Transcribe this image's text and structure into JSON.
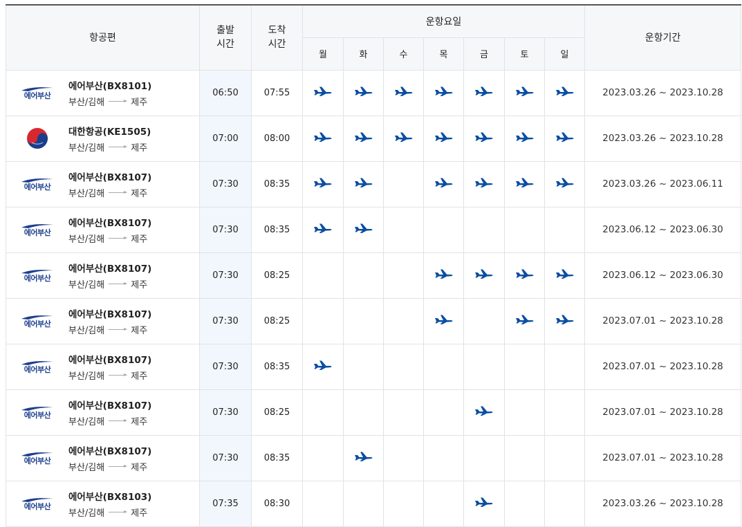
{
  "headers": {
    "flight": "항공편",
    "departure": "출발\n시간",
    "arrival": "도착\n시간",
    "days_group": "운항요일",
    "period": "운항기간",
    "days": [
      "월",
      "화",
      "수",
      "목",
      "금",
      "토",
      "일"
    ]
  },
  "rows": [
    {
      "airline": "에어부산(BX8101)",
      "logo": "air-busan-logo",
      "origin": "부산/김해",
      "destination": "제주",
      "dep": "06:50",
      "arr": "07:55",
      "days": [
        1,
        1,
        1,
        1,
        1,
        1,
        1
      ],
      "period": "2023.03.26 ~ 2023.10.28"
    },
    {
      "airline": "대한항공(KE1505)",
      "logo": "korean-air-logo",
      "origin": "부산/김해",
      "destination": "제주",
      "dep": "07:00",
      "arr": "08:00",
      "days": [
        1,
        1,
        1,
        1,
        1,
        1,
        1
      ],
      "period": "2023.03.26 ~ 2023.10.28"
    },
    {
      "airline": "에어부산(BX8107)",
      "logo": "air-busan-logo",
      "origin": "부산/김해",
      "destination": "제주",
      "dep": "07:30",
      "arr": "08:35",
      "days": [
        1,
        1,
        0,
        1,
        1,
        1,
        1
      ],
      "period": "2023.03.26 ~ 2023.06.11"
    },
    {
      "airline": "에어부산(BX8107)",
      "logo": "air-busan-logo",
      "origin": "부산/김해",
      "destination": "제주",
      "dep": "07:30",
      "arr": "08:35",
      "days": [
        1,
        1,
        0,
        0,
        0,
        0,
        0
      ],
      "period": "2023.06.12 ~ 2023.06.30"
    },
    {
      "airline": "에어부산(BX8107)",
      "logo": "air-busan-logo",
      "origin": "부산/김해",
      "destination": "제주",
      "dep": "07:30",
      "arr": "08:25",
      "days": [
        0,
        0,
        0,
        1,
        1,
        1,
        1
      ],
      "period": "2023.06.12 ~ 2023.06.30"
    },
    {
      "airline": "에어부산(BX8107)",
      "logo": "air-busan-logo",
      "origin": "부산/김해",
      "destination": "제주",
      "dep": "07:30",
      "arr": "08:25",
      "days": [
        0,
        0,
        0,
        1,
        0,
        1,
        1
      ],
      "period": "2023.07.01 ~ 2023.10.28"
    },
    {
      "airline": "에어부산(BX8107)",
      "logo": "air-busan-logo",
      "origin": "부산/김해",
      "destination": "제주",
      "dep": "07:30",
      "arr": "08:35",
      "days": [
        1,
        0,
        0,
        0,
        0,
        0,
        0
      ],
      "period": "2023.07.01 ~ 2023.10.28"
    },
    {
      "airline": "에어부산(BX8107)",
      "logo": "air-busan-logo",
      "origin": "부산/김해",
      "destination": "제주",
      "dep": "07:30",
      "arr": "08:25",
      "days": [
        0,
        0,
        0,
        0,
        1,
        0,
        0
      ],
      "period": "2023.07.01 ~ 2023.10.28"
    },
    {
      "airline": "에어부산(BX8107)",
      "logo": "air-busan-logo",
      "origin": "부산/김해",
      "destination": "제주",
      "dep": "07:30",
      "arr": "08:35",
      "days": [
        0,
        1,
        0,
        0,
        0,
        0,
        0
      ],
      "period": "2023.07.01 ~ 2023.10.28"
    },
    {
      "airline": "에어부산(BX8103)",
      "logo": "air-busan-logo",
      "origin": "부산/김해",
      "destination": "제주",
      "dep": "07:35",
      "arr": "08:30",
      "days": [
        0,
        0,
        0,
        0,
        1,
        0,
        0
      ],
      "period": "2023.03.26 ~ 2023.10.28"
    }
  ],
  "logo_text": {
    "air-busan-logo": "에어부산"
  },
  "colors": {
    "plane": "#0b4ea2",
    "header_bg": "#f6f7f9",
    "dep_col_bg": "#f2f7fd",
    "border": "#dfe3e8"
  }
}
